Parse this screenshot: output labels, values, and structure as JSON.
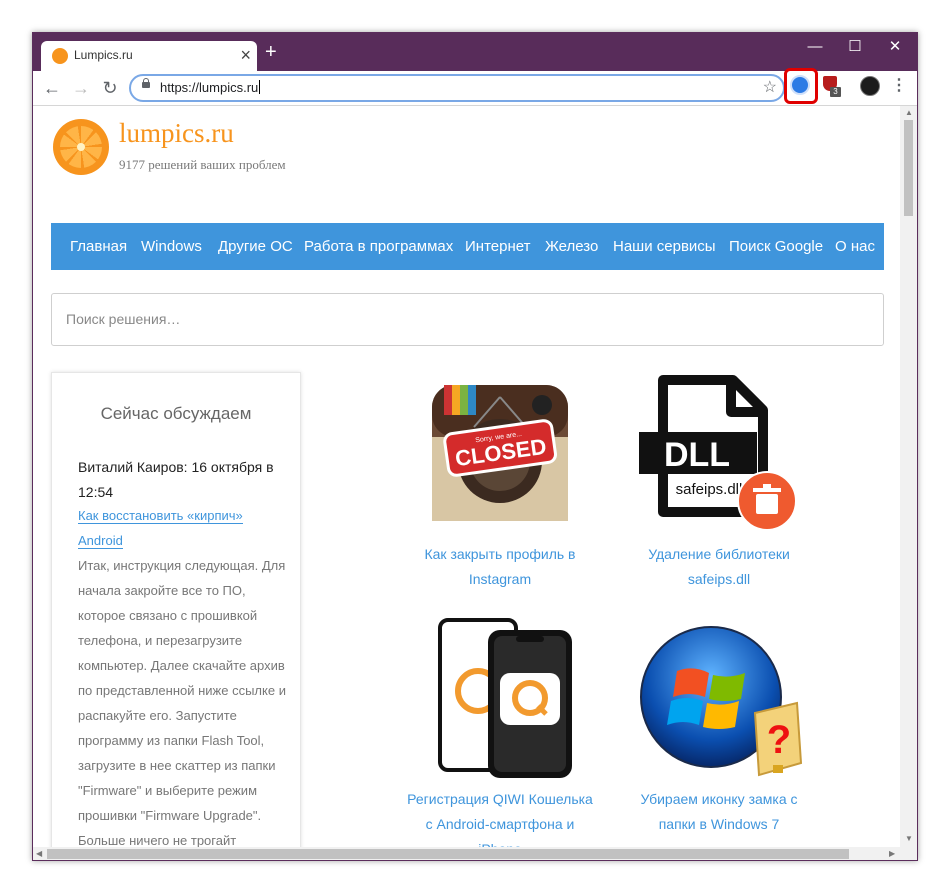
{
  "browser": {
    "tab_title": "Lumpics.ru",
    "url": "https://lumpics.ru",
    "extension_badge": "3"
  },
  "site": {
    "title": "lumpics.ru",
    "subtitle": "9177 решений ваших проблем",
    "nav": [
      "Главная",
      "Windows",
      "Другие ОС",
      "Работа в программах",
      "Интернет",
      "Железо",
      "Наши сервисы",
      "Поиск Google",
      "О нас"
    ],
    "search_placeholder": "Поиск решения…"
  },
  "sidebar": {
    "heading": "Сейчас обсуждаем",
    "author": "Виталий Каиров: 16 октября в 12:54",
    "link": "Как восстановить «кирпич» Android",
    "text": "Итак, инструкция следующая. Для начала закройте все то ПО, которое связано с прошивкой телефона, и перезагрузите компьютер. Далее скачайте архив по представленной ниже ссылке и распакуйте его. Запустите программу из папки Flash Tool, загрузите в нее скаттер из папки \"Firmware\" и выберите режим прошивки \"Firmware Upgrade\". Больше ничего не трогайт"
  },
  "articles": [
    {
      "title": "Как закрыть профиль в Instagram",
      "sign": "CLOSED",
      "sign_small": "Sorry, we are..."
    },
    {
      "title": "Удаление библиотеки safeips.dll",
      "ext": "DLL",
      "file": "safeips.dll"
    },
    {
      "title": "Регистрация QIWI Кошелька с Android-смартфона и iPhone"
    },
    {
      "title": "Убираем иконку замка с папки в Windows 7"
    }
  ],
  "colors": {
    "accent": "#3f95dc",
    "brand": "#f7941d",
    "titlebar": "#582c5a",
    "highlight": "#e00000"
  }
}
